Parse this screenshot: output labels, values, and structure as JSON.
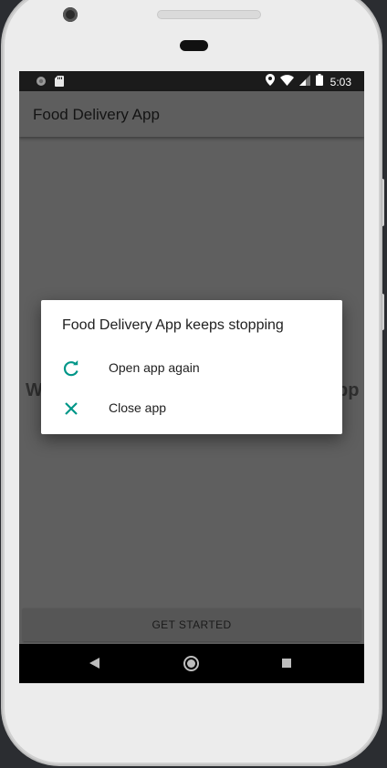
{
  "status_bar": {
    "time": "5:03",
    "left_icons": [
      "notification-dot-icon",
      "sd-card-icon"
    ],
    "right_icons": [
      "location-icon",
      "wifi-icon",
      "signal-icon",
      "battery-icon"
    ]
  },
  "app_bar": {
    "title": "Food Delivery App"
  },
  "background": {
    "welcome_text_left": "W",
    "welcome_text_right": "pp",
    "get_started_label": "GET STARTED"
  },
  "dialog": {
    "title": "Food Delivery App keeps stopping",
    "options": [
      {
        "label": "Open app again",
        "icon": "refresh-icon"
      },
      {
        "label": "Close app",
        "icon": "close-icon"
      }
    ]
  },
  "nav_bar": {
    "buttons": [
      "back-icon",
      "home-icon",
      "recents-icon"
    ]
  },
  "colors": {
    "accent": "#009688",
    "scrim": "#5f5f5f",
    "status_bar": "#1b1b1b"
  }
}
